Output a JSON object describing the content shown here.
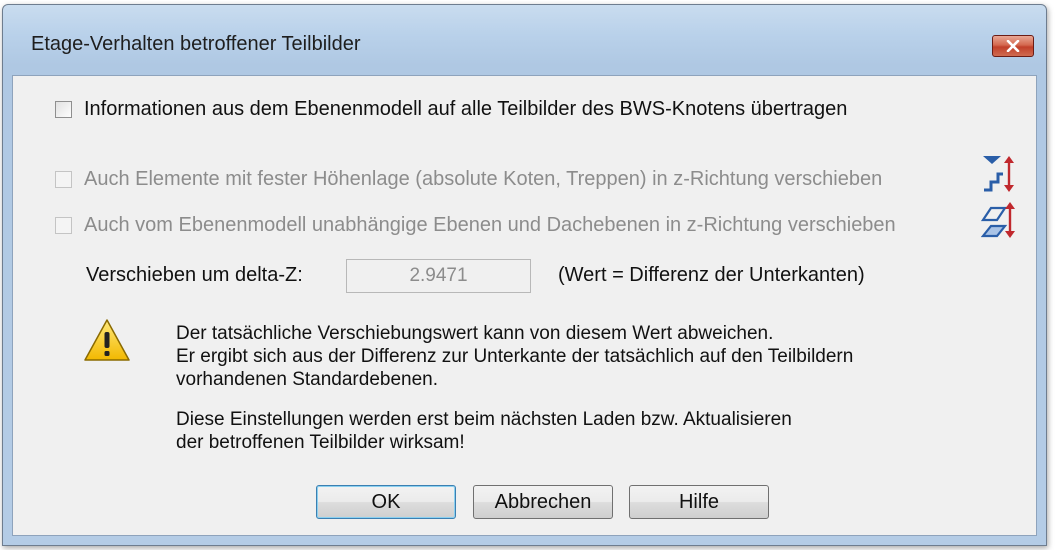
{
  "window": {
    "title": "Etage-Verhalten betroffener Teilbilder",
    "close_icon": "close-icon"
  },
  "options": [
    {
      "label": "Informationen aus dem Ebenenmodell auf alle Teilbilder des BWS-Knotens übertragen",
      "checked": false,
      "enabled": true
    },
    {
      "label": "Auch Elemente mit fester Höhenlage (absolute Koten, Treppen) in z-Richtung verschieben",
      "checked": false,
      "enabled": false,
      "icon": "stairs-shift-icon"
    },
    {
      "label": "Auch vom Ebenenmodell unabhängige Ebenen und Dachebenen in z-Richtung verschieben",
      "checked": false,
      "enabled": false,
      "icon": "planes-shift-icon"
    }
  ],
  "delta": {
    "label": "Verschieben um delta-Z:",
    "value": "2.9471",
    "hint": "(Wert = Differenz der Unterkanten)"
  },
  "warning": {
    "icon": "warning-icon",
    "lines": [
      "Der tatsächliche Verschiebungswert kann von diesem Wert abweichen.",
      "Er ergibt sich aus der Differenz zur Unterkante der tatsächlich auf den Teilbildern",
      "vorhandenen Standardebenen."
    ],
    "note_lines": [
      "Diese Einstellungen werden erst beim nächsten Laden bzw. Aktualisieren",
      "der betroffenen Teilbilder wirksam!"
    ]
  },
  "buttons": {
    "ok": "OK",
    "cancel": "Abbrechen",
    "help": "Hilfe"
  },
  "colors": {
    "accent": "#3c7fb1",
    "close_button": "#c1402a",
    "icon_blue": "#2a5ea8",
    "icon_red": "#c0282d"
  }
}
